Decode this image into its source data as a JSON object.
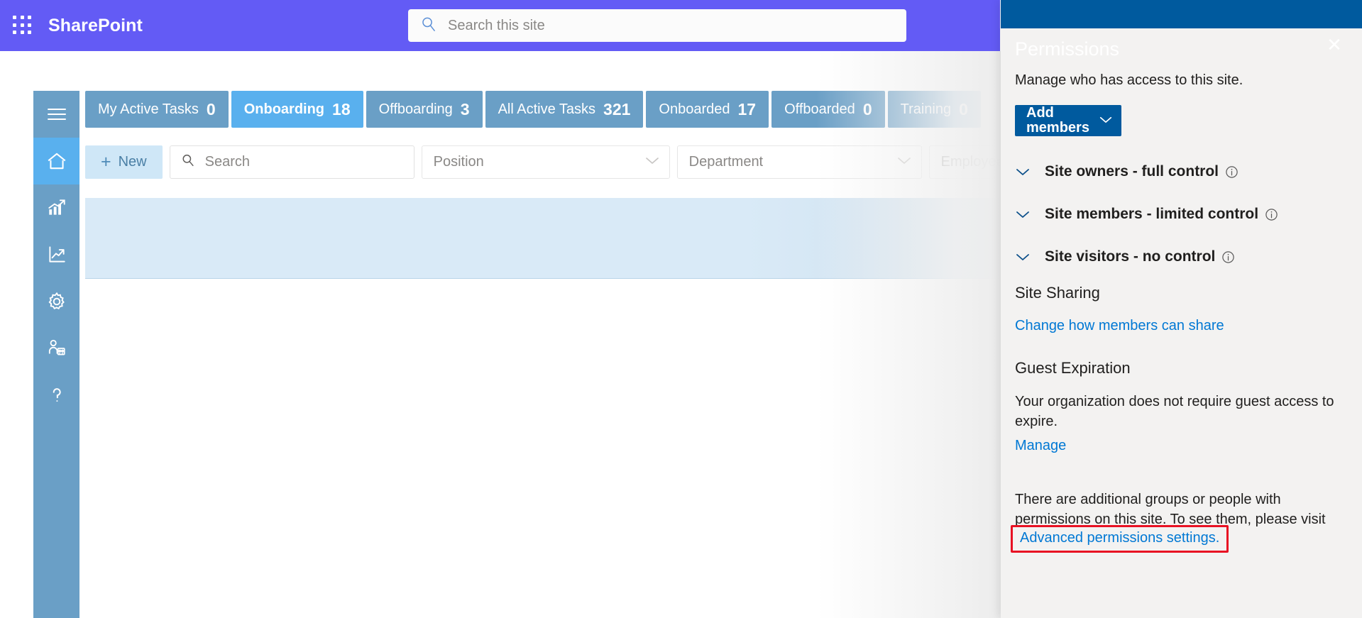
{
  "suite_bar": {
    "waffle_icon": "app-launcher-icon",
    "brand": "SharePoint",
    "search": {
      "icon": "search-icon",
      "value": "",
      "placeholder": "Search this site"
    },
    "bg_color": "#635bf5"
  },
  "rail": {
    "items": [
      {
        "name": "menu-icon",
        "label": "Menu",
        "active": false
      },
      {
        "name": "home-icon",
        "label": "Home",
        "active": true
      },
      {
        "name": "bar-chart-icon",
        "label": "Reports",
        "active": false
      },
      {
        "name": "line-chart-icon",
        "label": "Analytics",
        "active": false
      },
      {
        "name": "gear-icon",
        "label": "Settings",
        "active": false
      },
      {
        "name": "people-icon",
        "label": "People",
        "active": false
      },
      {
        "name": "help-icon",
        "label": "Help",
        "active": false
      }
    ],
    "bg_color": "#6a9fc6",
    "active_color": "#59b0ee"
  },
  "tabs": [
    {
      "label": "My Active Tasks",
      "count": "0",
      "active": false
    },
    {
      "label": "Onboarding",
      "count": "18",
      "active": true
    },
    {
      "label": "Offboarding",
      "count": "3",
      "active": false
    },
    {
      "label": "All Active Tasks",
      "count": "321",
      "active": false
    },
    {
      "label": "Onboarded",
      "count": "17",
      "active": false
    },
    {
      "label": "Offboarded",
      "count": "0",
      "active": false
    },
    {
      "label": "Training",
      "count": "0",
      "active": false
    }
  ],
  "command_bar": {
    "new_label": "New",
    "new_icon": "plus-icon",
    "search": {
      "icon": "search-icon",
      "value": "",
      "placeholder": "Search"
    },
    "filters": [
      {
        "label": "Position",
        "icon": "chevron-down-icon"
      },
      {
        "label": "Department",
        "icon": "chevron-down-icon"
      },
      {
        "label": "Employee",
        "icon": "chevron-down-icon"
      }
    ]
  },
  "panel": {
    "title": "Permissions",
    "close_icon": "close-icon",
    "subtitle": "Manage who has access to this site.",
    "add_members_label": "Add members",
    "add_members_icon": "chevron-down-icon",
    "groups": [
      {
        "label": "Site owners - full control",
        "chevron": "chevron-down-icon",
        "info": "info-icon"
      },
      {
        "label": "Site members - limited control",
        "chevron": "chevron-down-icon",
        "info": "info-icon"
      },
      {
        "label": "Site visitors - no control",
        "chevron": "chevron-down-icon",
        "info": "info-icon"
      }
    ],
    "site_sharing_title": "Site Sharing",
    "change_sharing_link": "Change how members can share",
    "guest_expiration_title": "Guest Expiration",
    "guest_expiration_text": "Your organization does not require guest access to expire.",
    "manage_link": "Manage",
    "extra_note": "There are additional groups or people with permissions on this site. To see them, please visit",
    "advanced_link": "Advanced permissions settings.",
    "highlight_color": "#e81123",
    "header_color": "#005a9e",
    "bg_color": "#f3f2f1"
  }
}
